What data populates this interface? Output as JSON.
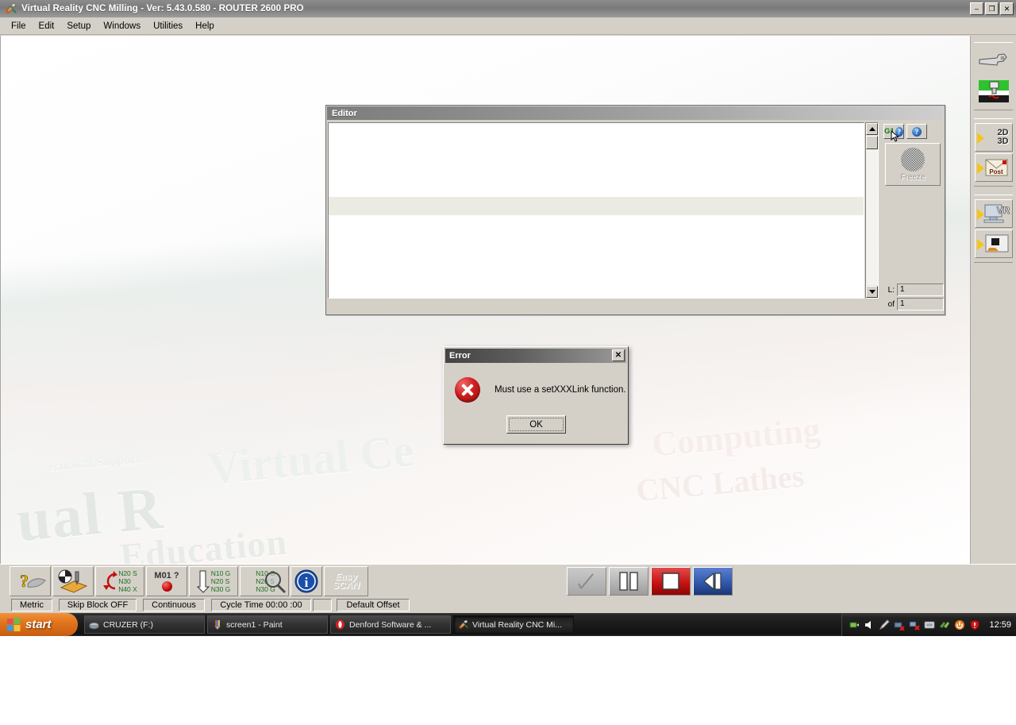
{
  "window": {
    "title": "Virtual Reality CNC Milling  -  Ver: 5.43.0.580 - ROUTER 2600 PRO",
    "icon": "cnc-app-icon",
    "minimize_label": "–",
    "restore_label": "❐",
    "close_label": "✕"
  },
  "menu": {
    "items": [
      {
        "label": "File"
      },
      {
        "label": "Edit"
      },
      {
        "label": "Setup"
      },
      {
        "label": "Windows"
      },
      {
        "label": "Utilities"
      },
      {
        "label": "Help"
      }
    ]
  },
  "wallpaper": {
    "lines": [
      {
        "text": "ual R"
      },
      {
        "text": "Education"
      },
      {
        "text": "Virtual Ce"
      },
      {
        "text": "Computing"
      },
      {
        "text": "CNC Lathes"
      },
      {
        "text": "echnical Support"
      }
    ]
  },
  "editor": {
    "title": "Editor",
    "content": "",
    "panel": {
      "g1_button": "G1",
      "help_glyph": "?",
      "freeze_label": "Freeze",
      "freeze_icon": "snowflake-icon",
      "line_label": "L:",
      "line_value": "1",
      "of_label": "of",
      "of_value": "1"
    }
  },
  "right_toolbar": {
    "items": [
      {
        "name": "spanner-tool-icon",
        "label": ""
      },
      {
        "name": "machine-setup-icon",
        "label": ""
      },
      {
        "name": "2d3d-view-icon",
        "label_top": "2D",
        "label_bottom": "3D"
      },
      {
        "name": "post-processor-icon",
        "label": "Post"
      },
      {
        "name": "vr-view-icon",
        "label": "VR"
      },
      {
        "name": "machine-view-icon",
        "label": ""
      }
    ]
  },
  "bottom_toolbar": {
    "left_buttons": [
      {
        "name": "help-tool-button",
        "icon": "question-tool-icon"
      },
      {
        "name": "tool-offsets-button",
        "icon": "tool-offset-icon"
      },
      {
        "name": "program-loop-button",
        "icon": "loop-icon",
        "lines": [
          "N20 S",
          "N30",
          "N40 X"
        ]
      },
      {
        "name": "optional-stop-button",
        "icon": "m01-stop-icon",
        "label": "M01 ?"
      },
      {
        "name": "single-block-button",
        "icon": "arrow-down-icon",
        "lines": [
          "N10 G",
          "N20 S",
          "N30 G"
        ]
      },
      {
        "name": "search-block-button",
        "icon": "magnifier-icon",
        "lines": [
          "N10 G",
          "N20 S",
          "N30 G"
        ]
      },
      {
        "name": "info-button",
        "icon": "info-icon"
      },
      {
        "name": "easy-scan-button",
        "label_top": "Easy",
        "label_bottom": "SCAN"
      }
    ],
    "center_buttons": [
      {
        "name": "cycle-start-button",
        "icon": "check-tick-icon",
        "state": "disabled"
      },
      {
        "name": "feed-hold-button",
        "icon": "pause-icon",
        "state": "enabled"
      },
      {
        "name": "emergency-stop-button",
        "icon": "stop-square-icon",
        "state": "enabled"
      },
      {
        "name": "reset-button",
        "icon": "step-back-icon",
        "state": "enabled"
      }
    ]
  },
  "status_bar": {
    "cells": [
      {
        "label": "Metric"
      },
      {
        "label": "Skip Block OFF"
      },
      {
        "label": "Continuous"
      },
      {
        "label": "Cycle Time 00:00 :00"
      },
      {
        "label": ""
      },
      {
        "label": "Default Offset"
      }
    ]
  },
  "error_dialog": {
    "title": "Error",
    "close_label": "✕",
    "icon": "error-cross-icon",
    "message": "Must use a setXXXLink function.",
    "ok_label": "OK"
  },
  "taskbar": {
    "start_label": "start",
    "items": [
      {
        "label": "CRUZER (F:)",
        "icon": "usb-drive-icon",
        "active": false
      },
      {
        "label": "screen1 - Paint",
        "icon": "paint-icon",
        "active": false
      },
      {
        "label": "Denford Software & ...",
        "icon": "opera-icon",
        "active": false
      },
      {
        "label": "Virtual Reality CNC Mi...",
        "icon": "cnc-app-icon",
        "active": true
      }
    ],
    "tray_icons": [
      "safely-remove-hardware-icon",
      "volume-icon",
      "pen-tablet-icon",
      "network-disconnected-icon",
      "network-error-icon",
      "display-icon",
      "fast-transfer-icon",
      "update-icon",
      "security-alert-icon"
    ],
    "clock": "12:59"
  },
  "colors": {
    "window_face": "#d4d0c8",
    "title_bar": "#7a7a7a",
    "error_red": "#d11f1f",
    "accent_green": "#0b7a0b",
    "taskbar_orange": "#e2751c"
  }
}
